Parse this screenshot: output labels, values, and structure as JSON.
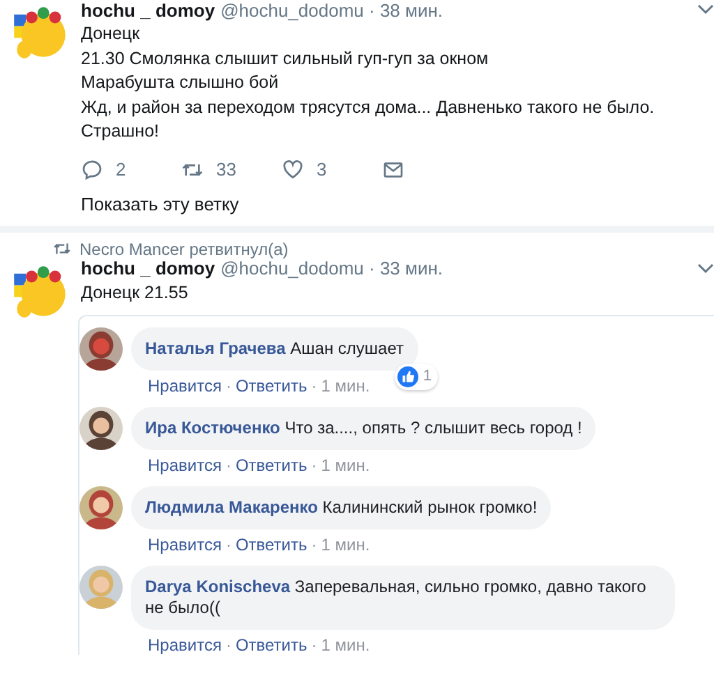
{
  "tweets": [
    {
      "display_name": "hochu _ domoy",
      "meta": "@hochu_dodomu · 38 мин.",
      "lines": [
        "Донецк",
        "21.30 Смолянка слышит сильный гуп-гуп за окном",
        "Марабушта слышно бой",
        "Жд, и район за переходом трясутся дома... Давненько такого не было.",
        "Страшно!"
      ],
      "actions": [
        {
          "kind": "reply",
          "count": "2"
        },
        {
          "kind": "retweet",
          "count": "33"
        },
        {
          "kind": "like",
          "count": "3"
        },
        {
          "kind": "message"
        }
      ],
      "show_thread": "Показать эту ветку"
    },
    {
      "retweeted_by": "Necro Mancer ретвитнул(а)",
      "display_name": "hochu _ domoy",
      "meta": "@hochu_dodomu · 33 мин.",
      "lines": [
        "Донецк 21.55"
      ],
      "embedded_comments": [
        {
          "author": "Наталья Грачева",
          "text": "Ашан слушает",
          "reaction_count": "1",
          "meta": [
            {
              "kind": "link",
              "text": "Нравится"
            },
            {
              "kind": "sep",
              "text": "·"
            },
            {
              "kind": "link",
              "text": "Ответить"
            },
            {
              "kind": "sep",
              "text": "·"
            },
            {
              "kind": "time",
              "text": "1 мин."
            }
          ]
        },
        {
          "author": "Ира Костюченко",
          "text": "Что за...., опять ?   слышит весь город !",
          "meta": [
            {
              "kind": "link",
              "text": "Нравится"
            },
            {
              "kind": "sep",
              "text": "·"
            },
            {
              "kind": "link",
              "text": "Ответить"
            },
            {
              "kind": "sep",
              "text": "·"
            },
            {
              "kind": "time",
              "text": "1 мин."
            }
          ]
        },
        {
          "author": "Людмила Макаренко",
          "text": "Калининский рынок громко!",
          "meta": [
            {
              "kind": "link",
              "text": "Нравится"
            },
            {
              "kind": "sep",
              "text": "·"
            },
            {
              "kind": "link",
              "text": "Ответить"
            },
            {
              "kind": "sep",
              "text": "·"
            },
            {
              "kind": "time",
              "text": "1 мин."
            }
          ]
        },
        {
          "author": "Darya Konischeva",
          "text": "Заперевальная, сильно громко, давно такого не было((",
          "meta": [
            {
              "kind": "link",
              "text": "Нравится"
            },
            {
              "kind": "sep",
              "text": "·"
            },
            {
              "kind": "link",
              "text": "Ответить"
            },
            {
              "kind": "sep",
              "text": "·"
            },
            {
              "kind": "time",
              "text": "1 мин."
            }
          ]
        }
      ]
    }
  ]
}
